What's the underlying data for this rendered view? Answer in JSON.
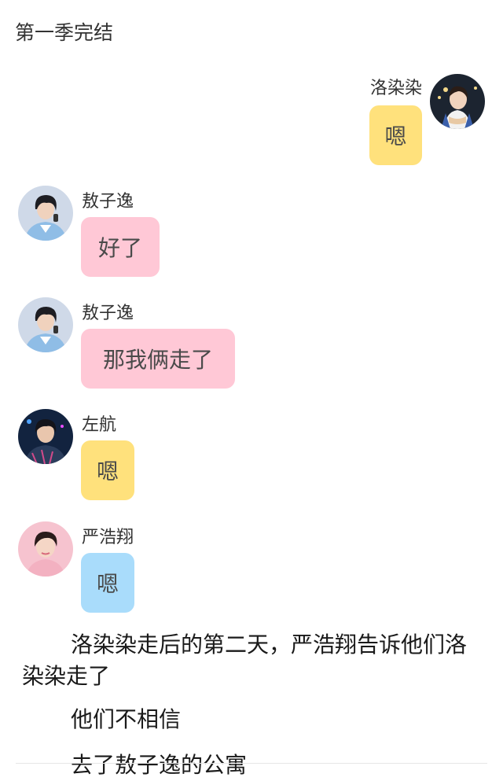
{
  "header": {
    "title": "第一季完结"
  },
  "colors": {
    "yellow_bubble": "#ffe17c",
    "pink_bubble": "#ffc8d6",
    "blue_bubble": "#a9dcfb"
  },
  "messages": [
    {
      "sender": "洛染染",
      "text": "嗯",
      "side": "right",
      "bubble_color": "yellow",
      "avatar": "girl-avatar"
    },
    {
      "sender": "敖子逸",
      "text": "好了",
      "side": "left",
      "bubble_color": "pink",
      "avatar": "boy-avatar-1"
    },
    {
      "sender": "敖子逸",
      "text": "那我俩走了",
      "side": "left",
      "bubble_color": "pink",
      "avatar": "boy-avatar-1"
    },
    {
      "sender": "左航",
      "text": "嗯",
      "side": "left",
      "bubble_color": "yellow",
      "avatar": "boy-avatar-2"
    },
    {
      "sender": "严浩翔",
      "text": "嗯",
      "side": "left",
      "bubble_color": "blue",
      "avatar": "boy-avatar-3"
    }
  ],
  "story": {
    "para1": "洛染染走后的第二天，严浩翔告诉他们洛染染走了",
    "para2": "他们不相信",
    "para3": "去了敖子逸的公寓"
  }
}
